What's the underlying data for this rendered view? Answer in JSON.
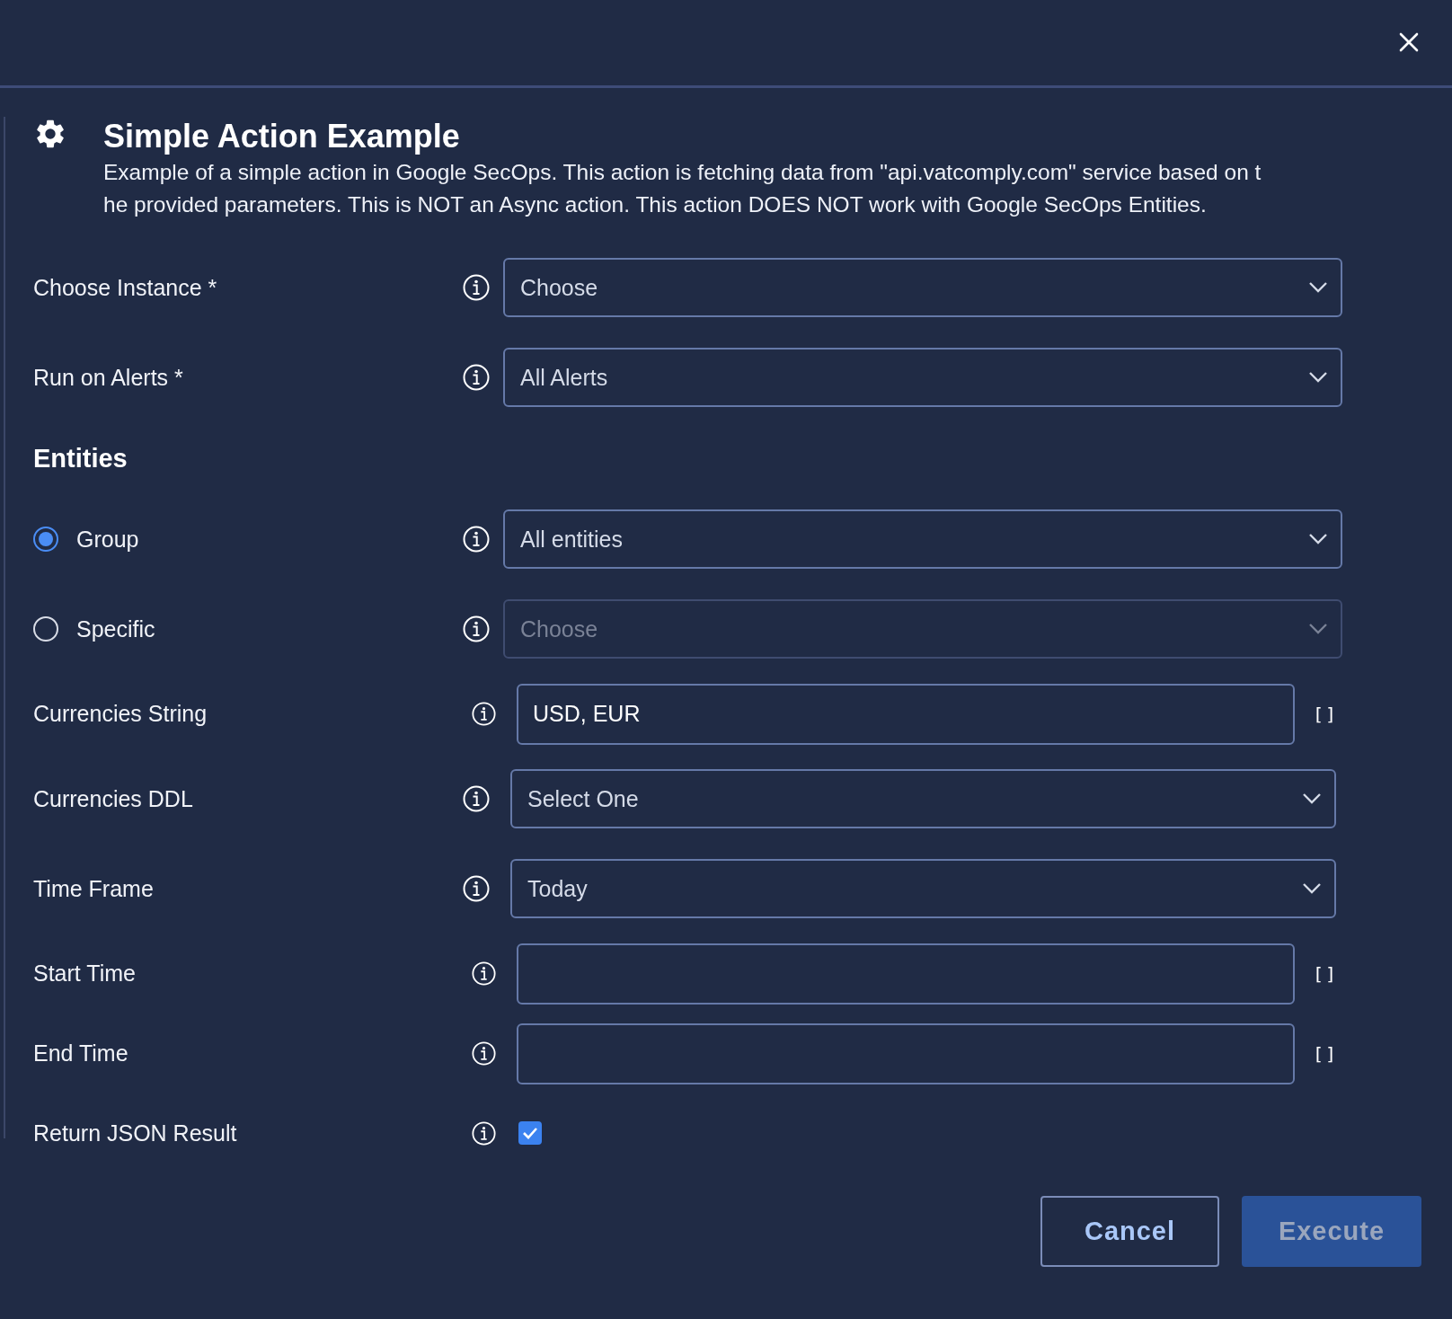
{
  "dialog": {
    "title": "Simple Action Example",
    "description_lines": [
      "Example of a simple action in Google SecOps. This action is fetching data from \"api.vatcomply.com\" service based on t",
      "he provided parameters. This is NOT an Async action. This action DOES NOT work with Google SecOps Entities."
    ]
  },
  "fields": [
    {
      "kind": "dropdown",
      "label": "Choose Instance *",
      "value": "Choose",
      "disabled": false
    },
    {
      "kind": "dropdown",
      "label": "Run on Alerts *",
      "value": "All Alerts",
      "disabled": false
    },
    {
      "kind": "heading",
      "label": "Entities"
    },
    {
      "kind": "radio-dropdown",
      "label": "Group",
      "selected": true,
      "value": "All entities",
      "disabled": false
    },
    {
      "kind": "radio-dropdown",
      "label": "Specific",
      "selected": false,
      "placeholder": "Choose",
      "disabled": true
    },
    {
      "kind": "text",
      "label": "Currencies String",
      "value": "USD, EUR",
      "bracket": "[]"
    },
    {
      "kind": "dropdown",
      "label": "Currencies DDL",
      "value": "Select One",
      "disabled": false
    },
    {
      "kind": "dropdown",
      "label": "Time Frame",
      "value": "Today",
      "disabled": false
    },
    {
      "kind": "text",
      "label": "Start Time",
      "bracket": "[]"
    },
    {
      "kind": "text",
      "label": "End Time",
      "bracket": "[]"
    },
    {
      "kind": "checkbox",
      "label": "Return JSON Result",
      "checked": true
    }
  ],
  "buttons": [
    {
      "label": "Cancel",
      "kind": "secondary"
    },
    {
      "label": "Execute",
      "kind": "primary"
    }
  ]
}
